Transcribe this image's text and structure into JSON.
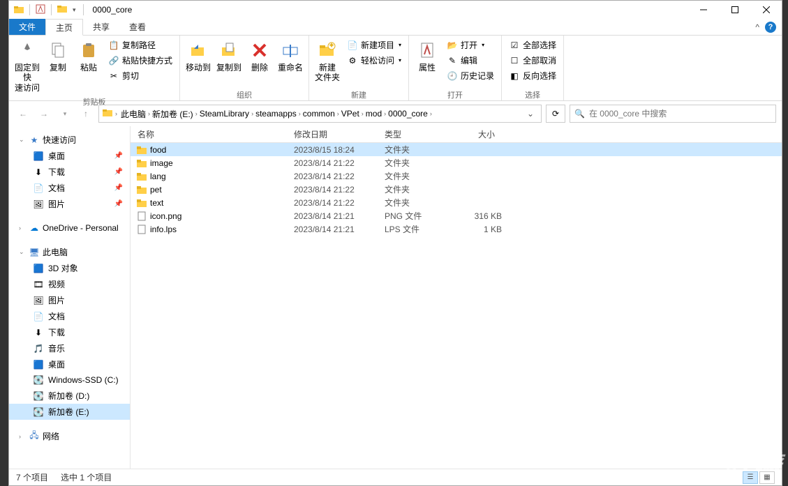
{
  "title": "0000_core",
  "tabs": {
    "file": "文件",
    "home": "主页",
    "share": "共享",
    "view": "查看"
  },
  "ribbon": {
    "groups": {
      "clipboard": "剪贴板",
      "organize": "组织",
      "new": "新建",
      "open": "打开",
      "select": "选择"
    },
    "pin": "固定到快\n速访问",
    "copy": "复制",
    "paste": "粘贴",
    "copy_path": "复制路径",
    "paste_shortcut": "粘贴快捷方式",
    "cut": "剪切",
    "move_to": "移动到",
    "copy_to": "复制到",
    "delete": "删除",
    "rename": "重命名",
    "new_folder": "新建\n文件夹",
    "new_item": "新建项目",
    "easy_access": "轻松访问",
    "properties": "属性",
    "open_btn": "打开",
    "edit": "编辑",
    "history": "历史记录",
    "select_all": "全部选择",
    "select_none": "全部取消",
    "invert": "反向选择"
  },
  "breadcrumbs": [
    "此电脑",
    "新加卷 (E:)",
    "SteamLibrary",
    "steamapps",
    "common",
    "VPet",
    "mod",
    "0000_core"
  ],
  "search_placeholder": "在 0000_core 中搜索",
  "nav": {
    "quick_access": "快速访问",
    "quick_items": [
      "桌面",
      "下载",
      "文档",
      "图片"
    ],
    "onedrive": "OneDrive - Personal",
    "this_pc": "此电脑",
    "pc_items": [
      "3D 对象",
      "视频",
      "图片",
      "文档",
      "下载",
      "音乐",
      "桌面",
      "Windows-SSD (C:)",
      "新加卷 (D:)",
      "新加卷 (E:)"
    ],
    "network": "网络"
  },
  "columns": {
    "name": "名称",
    "date": "修改日期",
    "type": "类型",
    "size": "大小"
  },
  "files": [
    {
      "name": "food",
      "date": "2023/8/15 18:24",
      "type": "文件夹",
      "size": "",
      "kind": "folder",
      "selected": true
    },
    {
      "name": "image",
      "date": "2023/8/14 21:22",
      "type": "文件夹",
      "size": "",
      "kind": "folder"
    },
    {
      "name": "lang",
      "date": "2023/8/14 21:22",
      "type": "文件夹",
      "size": "",
      "kind": "folder"
    },
    {
      "name": "pet",
      "date": "2023/8/14 21:22",
      "type": "文件夹",
      "size": "",
      "kind": "folder"
    },
    {
      "name": "text",
      "date": "2023/8/14 21:22",
      "type": "文件夹",
      "size": "",
      "kind": "folder"
    },
    {
      "name": "icon.png",
      "date": "2023/8/14 21:21",
      "type": "PNG 文件",
      "size": "316 KB",
      "kind": "file"
    },
    {
      "name": "info.lps",
      "date": "2023/8/14 21:21",
      "type": "LPS 文件",
      "size": "1 KB",
      "kind": "file"
    }
  ],
  "status": {
    "count": "7 个项目",
    "selected": "选中 1 个项目"
  },
  "watermark": "§ 九游",
  "colors": {
    "accent": "#1979ca",
    "selection": "#cce8ff",
    "folder": "#ffcf48"
  }
}
